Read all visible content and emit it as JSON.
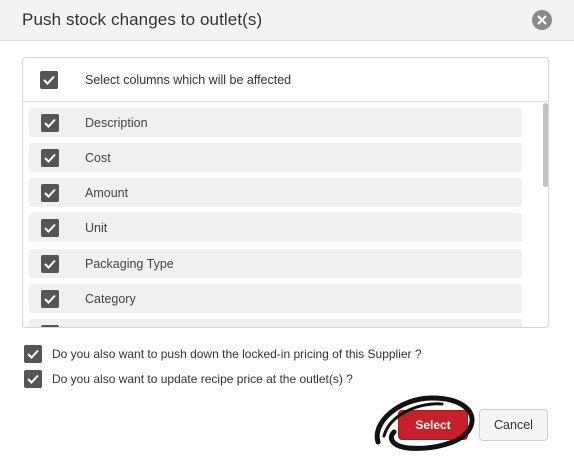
{
  "dialog": {
    "title": "Push stock changes to outlet(s)",
    "close_icon": "close-icon"
  },
  "columns_panel": {
    "select_all_label": "Select columns which will be affected",
    "select_all_checked": true,
    "items": [
      {
        "label": "Description",
        "checked": true
      },
      {
        "label": "Cost",
        "checked": true
      },
      {
        "label": "Amount",
        "checked": true
      },
      {
        "label": "Unit",
        "checked": true
      },
      {
        "label": "Packaging Type",
        "checked": true
      },
      {
        "label": "Category",
        "checked": true
      },
      {
        "label": "",
        "checked": true
      }
    ]
  },
  "options": [
    {
      "label": "Do you also want to push down the locked-in pricing of this Supplier ?",
      "checked": true
    },
    {
      "label": "Do you also want to update recipe price at the outlet(s) ?",
      "checked": true
    }
  ],
  "buttons": {
    "select_label": "Select",
    "cancel_label": "Cancel"
  },
  "colors": {
    "accent_red": "#c6202a",
    "checkbox": "#555555",
    "annotation": "#111111"
  }
}
